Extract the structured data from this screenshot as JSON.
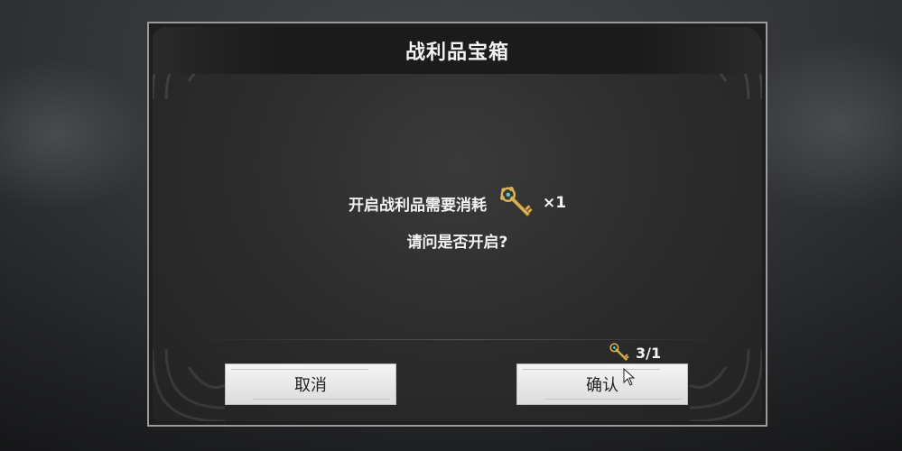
{
  "dialog": {
    "title": "战利品宝箱",
    "message_prefix": "开启战利品需要消耗",
    "message_quantity": "×1",
    "question": "请问是否开启?",
    "cost_count": "3/1",
    "cancel_label": "取消",
    "confirm_label": "确认",
    "item_icon": "golden-key-icon"
  },
  "colors": {
    "panel_bg": "#2c2c2c",
    "title_bar": "#1b1b1b",
    "text": "#f2f2f2",
    "button_bg": "#e8e8e8",
    "key_gold": "#d8b35a"
  }
}
